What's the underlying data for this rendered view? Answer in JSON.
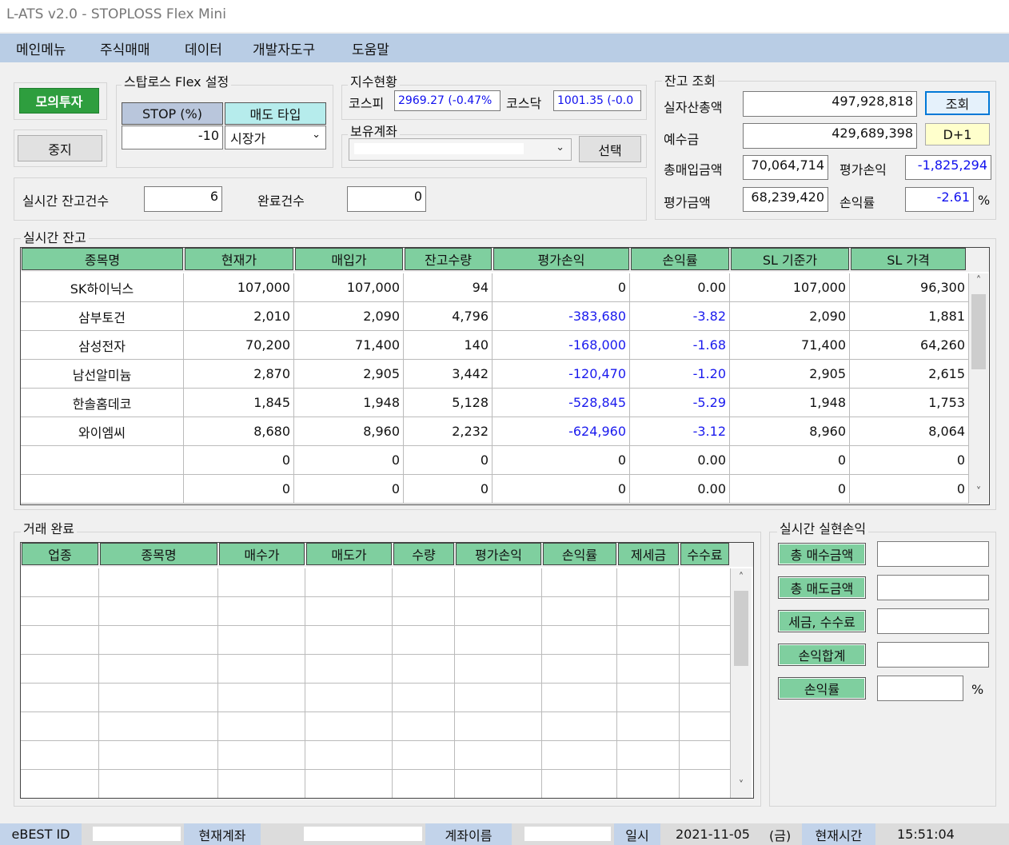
{
  "window": {
    "title": "L-ATS v2.0 - STOPLOSS Flex Mini"
  },
  "menu": [
    "메인메뉴",
    "주식매매",
    "데이터",
    "개발자도구",
    "도움말"
  ],
  "mode": {
    "mock_label": "모의투자",
    "stop_label": "중지",
    "mock_color": "#2e9e3e"
  },
  "stoploss": {
    "title": "스탑로스 Flex 설정",
    "stop_header": "STOP (%)",
    "type_header": "매도 타입",
    "stop_value": "-10",
    "type_value": "시장가"
  },
  "index": {
    "title": "지수현황",
    "kospi_label": "코스피",
    "kospi_value": "2969.27 (-0.47%",
    "kosdaq_label": "코스닥",
    "kosdaq_value": "1001.35 (-0.0"
  },
  "account": {
    "title": "보유계좌",
    "select_label": "선택"
  },
  "counts": {
    "realtime_label": "실시간 잔고건수",
    "realtime_value": "6",
    "done_label": "완료건수",
    "done_value": "0"
  },
  "balance": {
    "title": "잔고 조회",
    "total_assets_label": "실자산총액",
    "total_assets": "497,928,818",
    "query_label": "조회",
    "deposit_label": "예수금",
    "deposit": "429,689,398",
    "d1_label": "D+1",
    "buy_total_label": "총매입금액",
    "buy_total": "70,064,714",
    "eval_pl_label": "평가손익",
    "eval_pl": "-1,825,294",
    "eval_amount_label": "평가금액",
    "eval_amount": "68,239,420",
    "pl_rate_label": "손익률",
    "pl_rate": "-2.61",
    "pct": "%"
  },
  "holdings": {
    "title": "실시간 잔고",
    "columns": [
      "종목명",
      "현재가",
      "매입가",
      "잔고수량",
      "평가손익",
      "손익률",
      "SL 기준가",
      "SL 가격"
    ],
    "rows": [
      [
        "SK하이닉스",
        "107,000",
        "107,000",
        "94",
        "0",
        "0.00",
        "107,000",
        "96,300"
      ],
      [
        "삼부토건",
        "2,010",
        "2,090",
        "4,796",
        "-383,680",
        "-3.82",
        "2,090",
        "1,881"
      ],
      [
        "삼성전자",
        "70,200",
        "71,400",
        "140",
        "-168,000",
        "-1.68",
        "71,400",
        "64,260"
      ],
      [
        "남선알미늄",
        "2,870",
        "2,905",
        "3,442",
        "-120,470",
        "-1.20",
        "2,905",
        "2,615"
      ],
      [
        "한솔홈데코",
        "1,845",
        "1,948",
        "5,128",
        "-528,845",
        "-5.29",
        "1,948",
        "1,753"
      ],
      [
        "와이엠씨",
        "8,680",
        "8,960",
        "2,232",
        "-624,960",
        "-3.12",
        "8,960",
        "8,064"
      ],
      [
        "",
        "0",
        "0",
        "0",
        "0",
        "0.00",
        "0",
        "0"
      ],
      [
        "",
        "0",
        "0",
        "0",
        "0",
        "0.00",
        "0",
        "0"
      ]
    ]
  },
  "trades": {
    "title": "거래 완료",
    "columns": [
      "업종",
      "종목명",
      "매수가",
      "매도가",
      "수량",
      "평가손익",
      "손익률",
      "제세금",
      "수수료"
    ]
  },
  "realized": {
    "title": "실시간 실현손익",
    "buy_total_label": "총 매수금액",
    "sell_total_label": "총 매도금액",
    "tax_fee_label": "세금, 수수료",
    "pl_sum_label": "손익합계",
    "pl_rate_label": "손익률",
    "pct": "%"
  },
  "status": {
    "id_label": "eBEST ID",
    "account_label": "현재계좌",
    "account_name_label": "계좌이름",
    "date_label": "일시",
    "date": "2021-11-05",
    "weekday": "(금)",
    "time_label": "현재시간",
    "time": "15:51:04"
  }
}
